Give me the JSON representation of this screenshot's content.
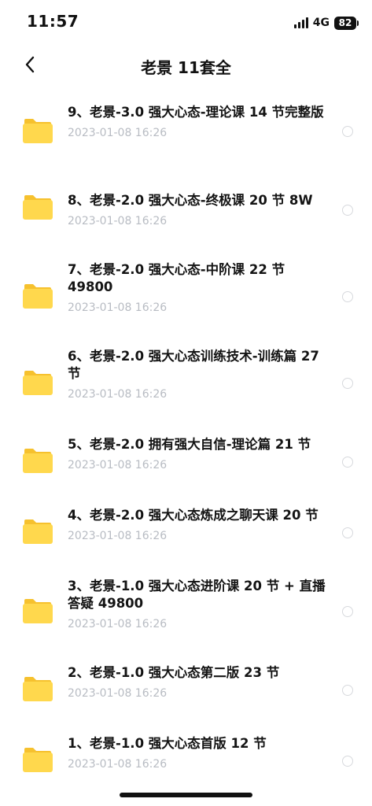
{
  "status_bar": {
    "time": "11:57",
    "network": "4G",
    "battery": "82",
    "icons": [
      "signal-icon",
      "battery-icon"
    ]
  },
  "nav": {
    "title": "老景 11套全",
    "back_icon": "chevron-left-icon"
  },
  "files": [
    {
      "name": "9、老景-3.0 强大心态-理论课 14 节完整版",
      "date": "2023-01-08 16:26"
    },
    {
      "name": "8、老景-2.0 强大心态-终极课 20 节 8W",
      "date": "2023-01-08 16:26"
    },
    {
      "name": "7、老景-2.0 强大心态-中阶课 22 节 49800",
      "date": "2023-01-08 16:26"
    },
    {
      "name": "6、老景-2.0 强大心态训练技术-训练篇 27 节",
      "date": "2023-01-08 16:26"
    },
    {
      "name": "5、老景-2.0 拥有强大自信-理论篇 21 节",
      "date": "2023-01-08 16:26"
    },
    {
      "name": "4、老景-2.0 强大心态炼成之聊天课 20 节",
      "date": "2023-01-08 16:26"
    },
    {
      "name": "3、老景-1.0 强大心态进阶课 20 节 + 直播答疑 49800",
      "date": "2023-01-08 16:26"
    },
    {
      "name": "2、老景-1.0 强大心态第二版 23 节",
      "date": "2023-01-08 16:26"
    },
    {
      "name": "1、老景-1.0 强大心态首版 12 节",
      "date": "2023-01-08 16:26"
    }
  ],
  "colors": {
    "folder_body": "#FFD84D",
    "folder_tab": "#F6C12E",
    "date_text": "#B8BCC3",
    "radio_border": "#D7D9DD"
  }
}
